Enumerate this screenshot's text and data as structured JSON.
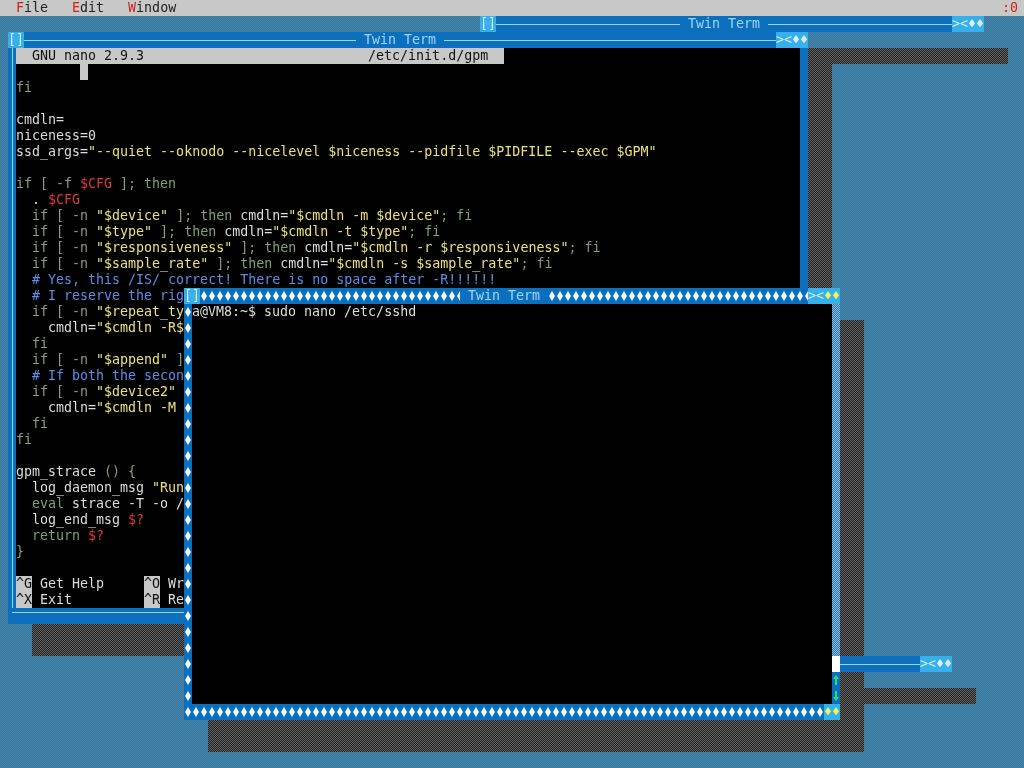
{
  "menu_bar": {
    "items": [
      {
        "label": "File"
      },
      {
        "label": "Edit"
      },
      {
        "label": "Window"
      }
    ],
    "display": ":0"
  },
  "windows": [
    {
      "title": "Twin Term",
      "active": false,
      "buttons": [
        {
          "kind": "close",
          "label": "[]"
        },
        {
          "kind": "zoom",
          "label": "><"
        },
        {
          "kind": "roll",
          "label": "♦♦"
        }
      ]
    },
    {
      "title": "Twin Term",
      "active": false,
      "buttons": [
        {
          "kind": "close",
          "label": "[]"
        },
        {
          "kind": "zoom",
          "label": "><"
        },
        {
          "kind": "roll",
          "label": "♦♦"
        }
      ],
      "nano": {
        "version": "GNU nano 2.9.3",
        "file": "/etc/init.d/gpm",
        "lines": [
          {
            "segments": [
              {
                "kind": "keyword",
                "text": "fi"
              }
            ]
          },
          {
            "kind": "blank"
          },
          {
            "segments": [
              {
                "kind": "plain",
                "text": "cmdln="
              }
            ]
          },
          {
            "segments": [
              {
                "kind": "plain",
                "text": "niceness=0"
              }
            ]
          },
          {
            "segments": [
              {
                "kind": "plain",
                "text": "ssd_args="
              },
              {
                "kind": "string",
                "text": "\"--quiet --oknodo --nicelevel $niceness --pidfile $PIDFILE --exec $GPM\""
              }
            ]
          },
          {
            "kind": "blank"
          },
          {
            "segments": [
              {
                "kind": "keyword",
                "text": "if [ -f "
              },
              {
                "kind": "variable",
                "text": "$CFG"
              },
              {
                "kind": "keyword",
                "text": " ]; then"
              }
            ]
          },
          {
            "segments": [
              {
                "kind": "plain",
                "text": "  . "
              },
              {
                "kind": "variable",
                "text": "$CFG"
              }
            ]
          },
          {
            "segments": [
              {
                "kind": "keyword",
                "text": "  if [ -n "
              },
              {
                "kind": "string",
                "text": "\"$device\""
              },
              {
                "kind": "keyword",
                "text": " ]; then "
              },
              {
                "kind": "plain",
                "text": "cmdln="
              },
              {
                "kind": "string",
                "text": "\"$cmdln -m $device\""
              },
              {
                "kind": "keyword",
                "text": "; fi"
              }
            ]
          },
          {
            "segments": [
              {
                "kind": "keyword",
                "text": "  if [ -n "
              },
              {
                "kind": "string",
                "text": "\"$type\""
              },
              {
                "kind": "keyword",
                "text": " ]; then "
              },
              {
                "kind": "plain",
                "text": "cmdln="
              },
              {
                "kind": "string",
                "text": "\"$cmdln -t $type\""
              },
              {
                "kind": "keyword",
                "text": "; fi"
              }
            ]
          },
          {
            "segments": [
              {
                "kind": "keyword",
                "text": "  if [ -n "
              },
              {
                "kind": "string",
                "text": "\"$responsiveness\""
              },
              {
                "kind": "keyword",
                "text": " ]; then "
              },
              {
                "kind": "plain",
                "text": "cmdln="
              },
              {
                "kind": "string",
                "text": "\"$cmdln -r $responsiveness\""
              },
              {
                "kind": "keyword",
                "text": "; fi"
              }
            ]
          },
          {
            "segments": [
              {
                "kind": "keyword",
                "text": "  if [ -n "
              },
              {
                "kind": "string",
                "text": "\"$sample_rate\""
              },
              {
                "kind": "keyword",
                "text": " ]; then "
              },
              {
                "kind": "plain",
                "text": "cmdln="
              },
              {
                "kind": "string",
                "text": "\"$cmdln -s $sample_rate\""
              },
              {
                "kind": "keyword",
                "text": "; fi"
              }
            ]
          },
          {
            "segments": [
              {
                "kind": "comment",
                "text": "  # Yes, this /IS/ correct! There is no space after -R!!!!!!"
              }
            ]
          },
          {
            "segments": [
              {
                "kind": "comment",
                "text": "  # I reserve the rig"
              }
            ]
          },
          {
            "segments": [
              {
                "kind": "keyword",
                "text": "  if [ -n "
              },
              {
                "kind": "string",
                "text": "\"$repeat_ty"
              }
            ]
          },
          {
            "segments": [
              {
                "kind": "plain",
                "text": "    cmdln="
              },
              {
                "kind": "string",
                "text": "\"$cmdln -R$"
              }
            ]
          },
          {
            "segments": [
              {
                "kind": "keyword",
                "text": "  fi"
              }
            ]
          },
          {
            "segments": [
              {
                "kind": "keyword",
                "text": "  if [ -n "
              },
              {
                "kind": "string",
                "text": "\"$append\""
              },
              {
                "kind": "keyword",
                "text": " ]"
              }
            ]
          },
          {
            "segments": [
              {
                "kind": "comment",
                "text": "  # If both the secon"
              }
            ]
          },
          {
            "segments": [
              {
                "kind": "keyword",
                "text": "  if [ -n "
              },
              {
                "kind": "string",
                "text": "\"$device2\""
              }
            ]
          },
          {
            "segments": [
              {
                "kind": "plain",
                "text": "    cmdln="
              },
              {
                "kind": "string",
                "text": "\"$cmdln -M"
              }
            ]
          },
          {
            "segments": [
              {
                "kind": "keyword",
                "text": "  fi"
              }
            ]
          },
          {
            "segments": [
              {
                "kind": "keyword",
                "text": "fi"
              }
            ]
          },
          {
            "kind": "blank"
          },
          {
            "segments": [
              {
                "kind": "plain",
                "text": "gpm_strace "
              },
              {
                "kind": "keyword",
                "text": "() {"
              }
            ]
          },
          {
            "segments": [
              {
                "kind": "plain",
                "text": "  log_daemon_msg "
              },
              {
                "kind": "string",
                "text": "\"Run"
              }
            ]
          },
          {
            "segments": [
              {
                "kind": "keyword",
                "text": "  eval"
              },
              {
                "kind": "plain",
                "text": " strace -T -o /"
              }
            ]
          },
          {
            "segments": [
              {
                "kind": "plain",
                "text": "  log_end_msg "
              },
              {
                "kind": "variable",
                "text": "$?"
              }
            ]
          },
          {
            "segments": [
              {
                "kind": "keyword",
                "text": "  return "
              },
              {
                "kind": "variable",
                "text": "$?"
              }
            ]
          },
          {
            "segments": [
              {
                "kind": "keyword",
                "text": "}"
              }
            ]
          }
        ],
        "shortcuts": [
          [
            {
              "key": "^G",
              "label": "Get Help"
            },
            {
              "key": "^O",
              "label": "Wr"
            }
          ],
          [
            {
              "key": "^X",
              "label": "Exit"
            },
            {
              "key": "^R",
              "label": "Re"
            }
          ]
        ]
      }
    },
    {
      "title": "Twin Term",
      "active": true,
      "buttons": [
        {
          "kind": "close",
          "label": "[]"
        },
        {
          "kind": "zoom",
          "label": "><"
        },
        {
          "kind": "roll",
          "label": "♦♦"
        },
        {
          "kind": "corner",
          "label": "♦♦"
        }
      ],
      "terminal": {
        "lines": [
          "a@VM8:~$ sudo nano /etc/sshd"
        ]
      }
    },
    {
      "active": false,
      "buttons": [
        {
          "kind": "zoom",
          "label": "><"
        },
        {
          "kind": "roll",
          "label": "♦♦"
        }
      ]
    }
  ]
}
